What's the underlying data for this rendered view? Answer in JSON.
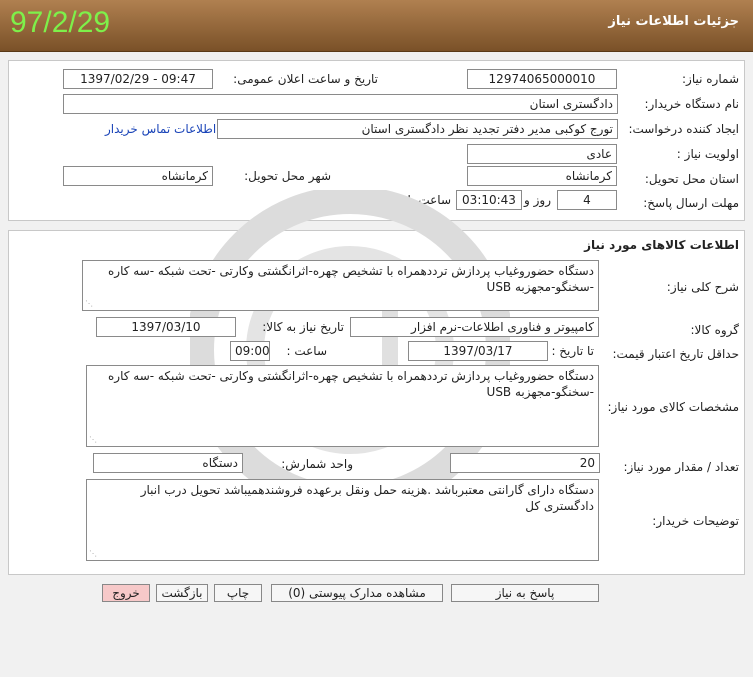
{
  "header": {
    "title": "جزئیات اطلاعات نیاز",
    "date_stamp": "97/2/29"
  },
  "info": {
    "need_number_label": "شماره نیاز:",
    "need_number": "12974065000010",
    "announce_label": "تاریخ و ساعت اعلان عمومی:",
    "announce_value": "1397/02/29 - 09:47",
    "buyer_label": "نام دستگاه خریدار:",
    "buyer_value": "دادگستری استان",
    "creator_label": "ایجاد کننده درخواست:",
    "creator_value": "تورج کوکبی مدیر دفتر تجدید نظر دادگستری استان",
    "contact_link": "اطلاعات تماس خریدار",
    "priority_label": "اولویت نیاز :",
    "priority_value": "عادی",
    "province_label": "استان محل تحویل:",
    "province_value": "کرمانشاه",
    "city_label": "شهر محل تحویل:",
    "city_value": "کرمانشاه",
    "deadline_label": "مهلت ارسال پاسخ:",
    "deadline_days": "4",
    "days_label": "روز و",
    "deadline_time": "03:10:43",
    "remaining_label": "ساعت باقی مانده"
  },
  "goods": {
    "section_title": "اطلاعات کالاهای مورد نیاز",
    "general_desc_label": "شرح کلی نیاز:",
    "general_desc": "دستگاه حضوروغیاب پردازش ترددهمراه با تشخیص چهره-اثرانگشتی وکارتی -تحت شبکه -سه کاره -سخنگو-مجهزبه USB",
    "group_label": "گروه کالا:",
    "group_value": "کامپیوتر و فناوری اطلاعات-نرم افزار",
    "need_date_label": "تاریخ نیاز به کالا:",
    "need_date": "1397/03/10",
    "validity_label": "حداقل تاریخ اعتبار قیمت:",
    "until_label": "تا تاریخ :",
    "validity_date": "1397/03/17",
    "time_label": "ساعت :",
    "validity_time": "09:00",
    "specs_label": "مشخصات کالای مورد نیاز:",
    "specs": "دستگاه حضوروغیاب پردازش ترددهمراه با تشخیص چهره-اثرانگشتی وکارتی -تحت شبکه -سه کاره -سخنگو-مجهزبه USB",
    "qty_label": "تعداد / مقدار مورد نیاز:",
    "qty_value": "20",
    "unit_label": "واحد شمارش:",
    "unit_value": "دستگاه",
    "buyer_notes_label": "توضیحات خریدار:",
    "buyer_notes": "دستگاه دارای گارانتی معتبرباشد .هزینه حمل ونقل برعهده فروشندهمیباشد تحویل درب انبار دادگستری کل"
  },
  "buttons": {
    "reply": "پاسخ به نیاز",
    "attachments": "مشاهده مدارک پیوستی (0)",
    "print": "چاپ",
    "back": "بازگشت",
    "exit": "خروج"
  }
}
